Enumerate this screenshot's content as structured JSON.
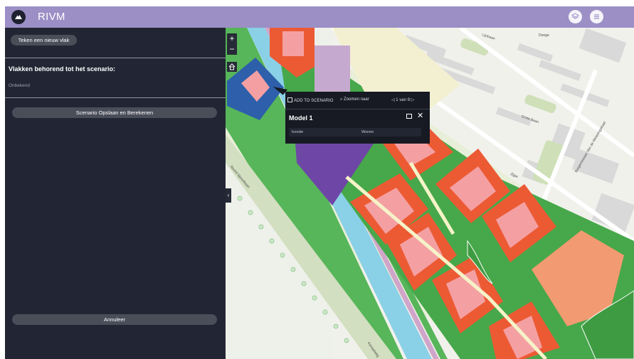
{
  "header": {
    "title": "RIVM",
    "logo_icon": "mountain-icon",
    "layers_icon": "layers-icon",
    "list_icon": "list-icon",
    "color": "#9b8fc6"
  },
  "sidebar": {
    "new_area_label": "Teken een nieuw vlak",
    "section_title": "Vlakken behorend tot het scenario:",
    "section_value": "Onbekend",
    "save_label": "Scenario Opslaan en Berekenen",
    "cancel_label": "Annuleer",
    "color": "#222634"
  },
  "map": {
    "zoom_in": "+",
    "zoom_out": "−",
    "home_icon": "home-icon",
    "collapse": "‹",
    "street_labels": [
      "Lijnbaan",
      "Donge",
      "Grote Baan",
      "Burgemeester Van de Weteringstraat",
      "Noord-Spoorbaan",
      "Kanaalweg",
      "Zijpe"
    ]
  },
  "popup": {
    "add_label": "ADD TO SCENARIO",
    "zoom_label": "Zoomen naar",
    "nav_prev": "◁",
    "nav_text": "1 van 9",
    "nav_next": "▷",
    "title": "Model 1",
    "close": "✕",
    "field_key": "functie",
    "field_value": "Wonen"
  }
}
